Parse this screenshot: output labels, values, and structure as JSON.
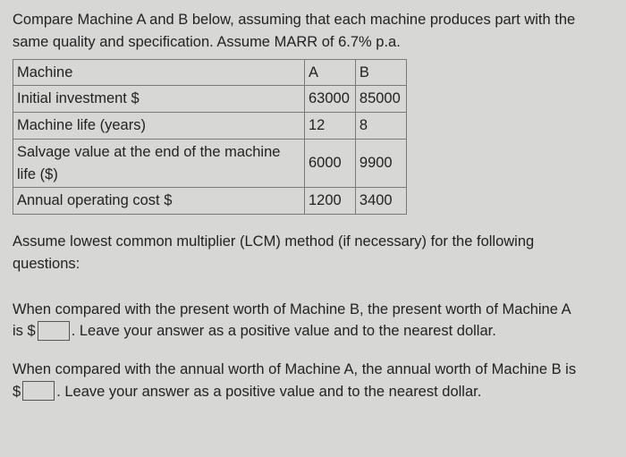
{
  "intro": {
    "line1": "Compare Machine A and B below, assuming that each machine produces part with the",
    "line2": "same quality and specification. Assume MARR of 6.7% p.a."
  },
  "table": {
    "header": {
      "label": "Machine",
      "a": "A",
      "b": "B"
    },
    "rows": [
      {
        "label": "Initial investment $",
        "a": "63000",
        "b": "85000"
      },
      {
        "label": "Machine life (years)",
        "a": "12",
        "b": "8"
      },
      {
        "label": "Salvage value at the end of the machine life ($)",
        "a": "6000",
        "b": "9900"
      },
      {
        "label": "Annual operating cost $",
        "a": "1200",
        "b": "3400"
      }
    ]
  },
  "assume": {
    "line1": "Assume lowest common multiplier (LCM) method (if necessary) for the following",
    "line2": "questions:"
  },
  "q1": {
    "line1": "When compared with the present worth of Machine B, the present worth of Machine A",
    "prefix": "is $",
    "suffix": ". Leave your answer as a positive value and to the nearest dollar."
  },
  "q2": {
    "line1": "When compared with the annual worth of Machine A, the annual worth of Machine B is",
    "prefix": "$",
    "suffix": ". Leave your answer as a positive value and to the nearest dollar."
  }
}
